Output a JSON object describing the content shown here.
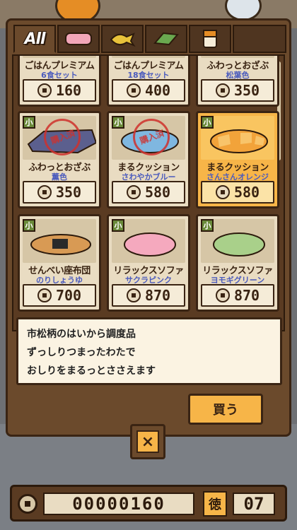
{
  "tabs": [
    {
      "label": "All",
      "icon": "all-tab",
      "active": true
    },
    {
      "label": "",
      "icon": "cushion-icon",
      "active": false
    },
    {
      "label": "",
      "icon": "toy-icon",
      "active": false
    },
    {
      "label": "",
      "icon": "mat-icon",
      "active": false
    },
    {
      "label": "",
      "icon": "box-icon",
      "active": false
    }
  ],
  "items_top": [
    {
      "name": "ごはんプレミアム",
      "sub": "6食セット",
      "price": "160"
    },
    {
      "name": "ごはんプレミアム",
      "sub": "18食セット",
      "price": "400"
    },
    {
      "name": "ふわっとおざぶ",
      "sub": "松葉色",
      "price": "350"
    }
  ],
  "items_mid": [
    {
      "name": "ふわっとおざぶ",
      "sub": "薫色",
      "price": "350",
      "size": "小",
      "sold": true,
      "sold_label": "購入済"
    },
    {
      "name": "まるクッション",
      "sub": "さわやかブルー",
      "price": "580",
      "size": "小",
      "sold": true,
      "sold_label": "購入済"
    },
    {
      "name": "まるクッション",
      "sub": "さんさんオレンジ",
      "price": "580",
      "size": "小",
      "sold": false,
      "selected": true
    }
  ],
  "items_bot": [
    {
      "name": "せんべい座布団",
      "sub": "のりしょうゆ",
      "price": "700",
      "size": "小"
    },
    {
      "name": "リラックスソファ",
      "sub": "サクラピンク",
      "price": "870",
      "size": "小"
    },
    {
      "name": "リラックスソファ",
      "sub": "ヨモギグリーン",
      "price": "870",
      "size": "小"
    }
  ],
  "description": {
    "line1": "市松柄のはいから調度品",
    "line2": "ずっしりつまったわたで",
    "line3": "おしりをまるっとささえます"
  },
  "buy_label": "買う",
  "close_label": "×",
  "wallet": {
    "coins": "00000160",
    "toku_label": "徳",
    "toku": "07"
  },
  "colors": {
    "accent": "#f7b548",
    "wood": "#6b4a2c",
    "sub_text": "#4b5bbd",
    "stamp": "#d0312d"
  }
}
